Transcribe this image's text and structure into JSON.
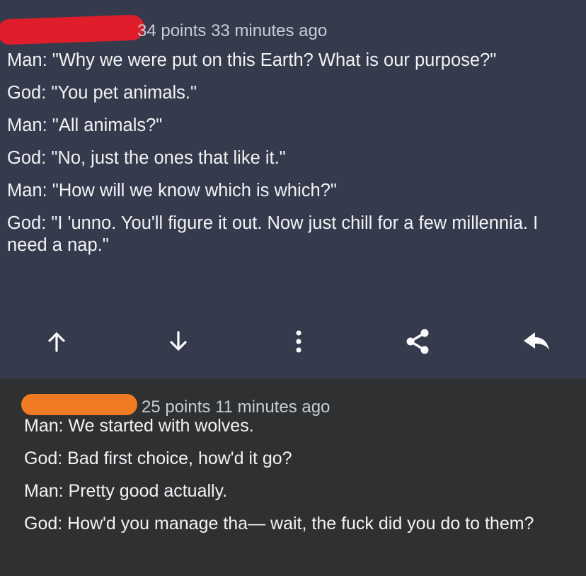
{
  "comments": [
    {
      "meta": "34 points 33 minutes ago",
      "lines": [
        "Man: \"Why we were put on this Earth? What is our purpose?\"",
        "God: \"You pet animals.\"",
        "Man: \"All animals?\"",
        "God: \"No, just the ones that like it.\"",
        "Man: \"How will we know which is which?\"",
        "God: \"I 'unno. You'll figure it out. Now just chill for a few millennia. I need a nap.\""
      ],
      "actions": [
        {
          "name": "upvote-arrow-icon"
        },
        {
          "name": "downvote-arrow-icon"
        },
        {
          "name": "more-options-icon"
        },
        {
          "name": "share-icon"
        },
        {
          "name": "reply-icon"
        }
      ]
    },
    {
      "meta": "25 points 11 minutes ago",
      "lines": [
        "Man: We started with wolves.",
        "God: Bad first choice, how'd it go?",
        "Man: Pretty good actually.",
        "God: How'd you manage tha— wait, the fuck did you do to them?"
      ]
    }
  ],
  "colors": {
    "top_background": "#353b4c",
    "bottom_background": "#2f3032",
    "redaction_red": "#e01e2b",
    "redaction_orange": "#f07b22",
    "text": "#f2f3f5",
    "meta_text": "#c9cdd6"
  }
}
